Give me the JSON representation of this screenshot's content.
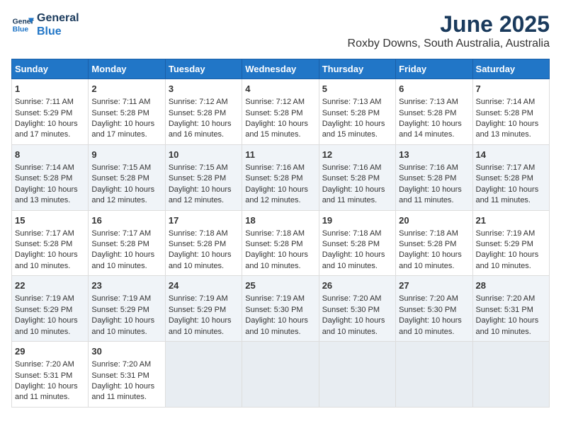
{
  "logo": {
    "line1": "General",
    "line2": "Blue"
  },
  "title": "June 2025",
  "subtitle": "Roxby Downs, South Australia, Australia",
  "headers": [
    "Sunday",
    "Monday",
    "Tuesday",
    "Wednesday",
    "Thursday",
    "Friday",
    "Saturday"
  ],
  "weeks": [
    [
      {
        "day": "1",
        "info": "Sunrise: 7:11 AM\nSunset: 5:29 PM\nDaylight: 10 hours\nand 17 minutes."
      },
      {
        "day": "2",
        "info": "Sunrise: 7:11 AM\nSunset: 5:28 PM\nDaylight: 10 hours\nand 17 minutes."
      },
      {
        "day": "3",
        "info": "Sunrise: 7:12 AM\nSunset: 5:28 PM\nDaylight: 10 hours\nand 16 minutes."
      },
      {
        "day": "4",
        "info": "Sunrise: 7:12 AM\nSunset: 5:28 PM\nDaylight: 10 hours\nand 15 minutes."
      },
      {
        "day": "5",
        "info": "Sunrise: 7:13 AM\nSunset: 5:28 PM\nDaylight: 10 hours\nand 15 minutes."
      },
      {
        "day": "6",
        "info": "Sunrise: 7:13 AM\nSunset: 5:28 PM\nDaylight: 10 hours\nand 14 minutes."
      },
      {
        "day": "7",
        "info": "Sunrise: 7:14 AM\nSunset: 5:28 PM\nDaylight: 10 hours\nand 13 minutes."
      }
    ],
    [
      {
        "day": "8",
        "info": "Sunrise: 7:14 AM\nSunset: 5:28 PM\nDaylight: 10 hours\nand 13 minutes."
      },
      {
        "day": "9",
        "info": "Sunrise: 7:15 AM\nSunset: 5:28 PM\nDaylight: 10 hours\nand 12 minutes."
      },
      {
        "day": "10",
        "info": "Sunrise: 7:15 AM\nSunset: 5:28 PM\nDaylight: 10 hours\nand 12 minutes."
      },
      {
        "day": "11",
        "info": "Sunrise: 7:16 AM\nSunset: 5:28 PM\nDaylight: 10 hours\nand 12 minutes."
      },
      {
        "day": "12",
        "info": "Sunrise: 7:16 AM\nSunset: 5:28 PM\nDaylight: 10 hours\nand 11 minutes."
      },
      {
        "day": "13",
        "info": "Sunrise: 7:16 AM\nSunset: 5:28 PM\nDaylight: 10 hours\nand 11 minutes."
      },
      {
        "day": "14",
        "info": "Sunrise: 7:17 AM\nSunset: 5:28 PM\nDaylight: 10 hours\nand 11 minutes."
      }
    ],
    [
      {
        "day": "15",
        "info": "Sunrise: 7:17 AM\nSunset: 5:28 PM\nDaylight: 10 hours\nand 10 minutes."
      },
      {
        "day": "16",
        "info": "Sunrise: 7:17 AM\nSunset: 5:28 PM\nDaylight: 10 hours\nand 10 minutes."
      },
      {
        "day": "17",
        "info": "Sunrise: 7:18 AM\nSunset: 5:28 PM\nDaylight: 10 hours\nand 10 minutes."
      },
      {
        "day": "18",
        "info": "Sunrise: 7:18 AM\nSunset: 5:28 PM\nDaylight: 10 hours\nand 10 minutes."
      },
      {
        "day": "19",
        "info": "Sunrise: 7:18 AM\nSunset: 5:28 PM\nDaylight: 10 hours\nand 10 minutes."
      },
      {
        "day": "20",
        "info": "Sunrise: 7:18 AM\nSunset: 5:28 PM\nDaylight: 10 hours\nand 10 minutes."
      },
      {
        "day": "21",
        "info": "Sunrise: 7:19 AM\nSunset: 5:29 PM\nDaylight: 10 hours\nand 10 minutes."
      }
    ],
    [
      {
        "day": "22",
        "info": "Sunrise: 7:19 AM\nSunset: 5:29 PM\nDaylight: 10 hours\nand 10 minutes."
      },
      {
        "day": "23",
        "info": "Sunrise: 7:19 AM\nSunset: 5:29 PM\nDaylight: 10 hours\nand 10 minutes."
      },
      {
        "day": "24",
        "info": "Sunrise: 7:19 AM\nSunset: 5:29 PM\nDaylight: 10 hours\nand 10 minutes."
      },
      {
        "day": "25",
        "info": "Sunrise: 7:19 AM\nSunset: 5:30 PM\nDaylight: 10 hours\nand 10 minutes."
      },
      {
        "day": "26",
        "info": "Sunrise: 7:20 AM\nSunset: 5:30 PM\nDaylight: 10 hours\nand 10 minutes."
      },
      {
        "day": "27",
        "info": "Sunrise: 7:20 AM\nSunset: 5:30 PM\nDaylight: 10 hours\nand 10 minutes."
      },
      {
        "day": "28",
        "info": "Sunrise: 7:20 AM\nSunset: 5:31 PM\nDaylight: 10 hours\nand 10 minutes."
      }
    ],
    [
      {
        "day": "29",
        "info": "Sunrise: 7:20 AM\nSunset: 5:31 PM\nDaylight: 10 hours\nand 11 minutes."
      },
      {
        "day": "30",
        "info": "Sunrise: 7:20 AM\nSunset: 5:31 PM\nDaylight: 10 hours\nand 11 minutes."
      },
      {
        "day": "",
        "info": ""
      },
      {
        "day": "",
        "info": ""
      },
      {
        "day": "",
        "info": ""
      },
      {
        "day": "",
        "info": ""
      },
      {
        "day": "",
        "info": ""
      }
    ]
  ]
}
